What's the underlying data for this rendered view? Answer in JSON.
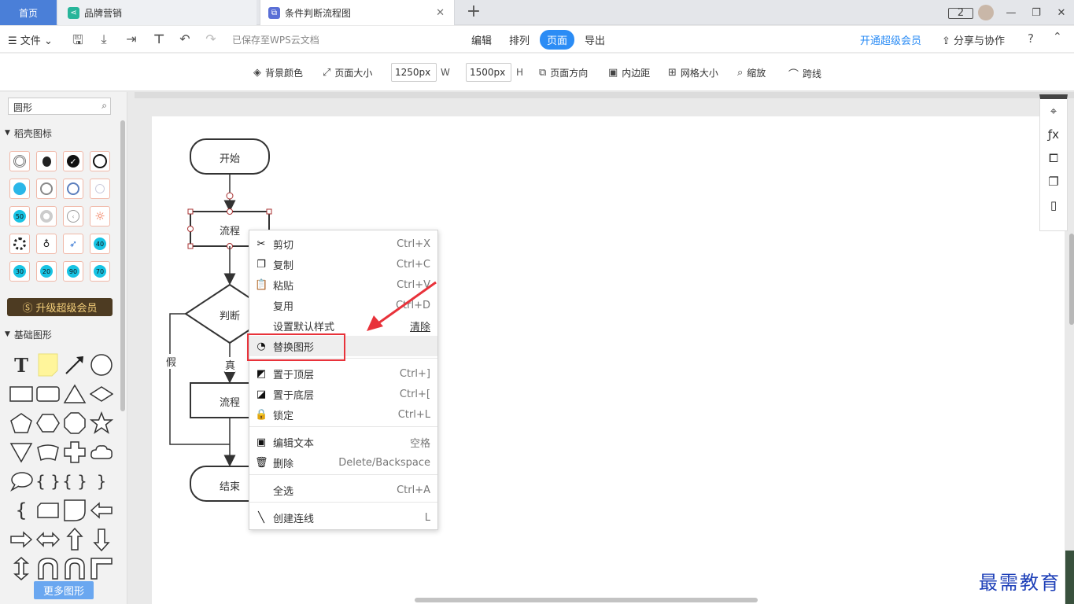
{
  "tabs": {
    "home": "首页",
    "brand": "品牌营销",
    "flow": "条件判断流程图",
    "add": "+",
    "close": "✕"
  },
  "window": {
    "badge": "2"
  },
  "menubar": {
    "file": "文件",
    "saved": "已保存至WPS云文档",
    "tabs": [
      "编辑",
      "排列",
      "页面",
      "导出"
    ],
    "active_tab": "页面",
    "vip": "开通超级会员",
    "share": "分享与协作",
    "help": "?"
  },
  "pagebar": {
    "bg_color": "背景颜色",
    "page_size": "页面大小",
    "width_value": "1250px",
    "width_unit": "W",
    "height_value": "1500px",
    "height_unit": "H",
    "orientation": "页面方向",
    "padding": "内边距",
    "grid_size": "网格大小",
    "zoom": "缩放",
    "jump_line": "跨线"
  },
  "left": {
    "search_value": "圆形",
    "section1": "稻壳图标",
    "icon_numbers": [
      "50",
      "40",
      "30",
      "20",
      "90",
      "70"
    ],
    "upgrade": "升级超级会员",
    "section2": "基础图形",
    "text_tool": "T",
    "more_shapes": "更多图形"
  },
  "flowchart": {
    "start": "开始",
    "process1": "流程",
    "decision": "判断",
    "false_label": "假",
    "true_label": "真",
    "process2": "流程",
    "end": "结束"
  },
  "context_menu": {
    "items": [
      {
        "label": "剪切",
        "key": "Ctrl+X",
        "icon": "scissors-icon"
      },
      {
        "label": "复制",
        "key": "Ctrl+C",
        "icon": "copy-icon"
      },
      {
        "label": "粘贴",
        "key": "Ctrl+V",
        "icon": "paste-icon"
      },
      {
        "label": "复用",
        "key": "Ctrl+D",
        "icon": ""
      },
      {
        "label": "设置默认样式",
        "key": "清除",
        "icon": ""
      },
      {
        "label": "替换图形",
        "key": "",
        "icon": "replace-shape-icon"
      },
      {
        "label": "置于顶层",
        "key": "Ctrl+]",
        "icon": "bring-front-icon"
      },
      {
        "label": "置于底层",
        "key": "Ctrl+[",
        "icon": "send-back-icon"
      },
      {
        "label": "锁定",
        "key": "Ctrl+L",
        "icon": "lock-icon"
      },
      {
        "label": "编辑文本",
        "key": "空格",
        "icon": "edit-text-icon"
      },
      {
        "label": "删除",
        "key": "Delete/Backspace",
        "icon": "trash-icon"
      },
      {
        "label": "全选",
        "key": "Ctrl+A",
        "icon": ""
      },
      {
        "label": "创建连线",
        "key": "L",
        "icon": "line-icon"
      }
    ],
    "hovered": "替换图形"
  },
  "colors": {
    "accent": "#2b8cf5",
    "home_tab": "#4a7fd8",
    "highlight": "#e8323a",
    "arrow": "#e8323a",
    "watermark": "#1d3fb8"
  },
  "watermark": "最需教育"
}
